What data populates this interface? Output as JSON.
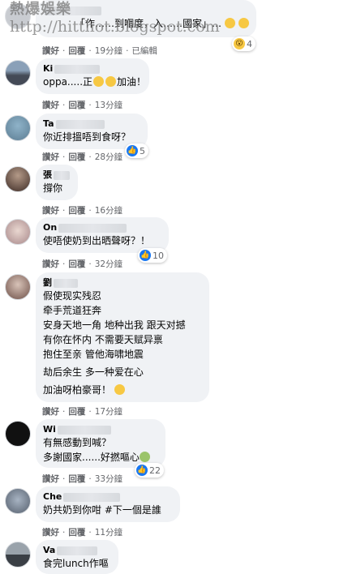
{
  "watermark": {
    "line1": "熱爆娛樂",
    "line2": "http://hitthot.blogspot.com"
  },
  "colors": {
    "bubble_bg": "#f0f2f5",
    "meta_text": "#65676b",
    "like_blue": "#1877f2",
    "emoji_yellow": "#f7c843"
  },
  "comments": [
    {
      "author": "",
      "lines": [
        "「作……到嗰度，入……國家」…"
      ],
      "actions": {
        "like": "讚好",
        "reply": "回覆",
        "time": "19分鐘",
        "extra": "已編輯"
      },
      "reactions": {
        "icons": [
          "wow-icon"
        ],
        "count": "4"
      }
    },
    {
      "author": "Ki",
      "lines": [
        "oppa.....正",
        "加油！"
      ],
      "actions": {
        "like": "讚好",
        "reply": "回覆",
        "time": "13分鐘"
      }
    },
    {
      "author": "Ta",
      "lines": [
        "你近排搵唔到食呀？"
      ],
      "actions": {
        "like": "讚好",
        "reply": "回覆",
        "time": "28分鐘"
      },
      "reactions": {
        "icons": [
          "like-icon"
        ],
        "count": "5"
      }
    },
    {
      "author": "張",
      "lines": [
        "撐你"
      ],
      "actions": {
        "like": "讚好",
        "reply": "回覆",
        "time": "16分鐘"
      }
    },
    {
      "author": "On",
      "lines": [
        "使唔使奶到出晒聲呀？！"
      ],
      "actions": {
        "like": "讚好",
        "reply": "回覆",
        "time": "32分鐘"
      },
      "reactions": {
        "icons": [
          "like-icon"
        ],
        "count": "10"
      }
    },
    {
      "author": "劉",
      "lines": [
        "假使现实残忍",
        "牵手荒道狂奔",
        "安身天地一角 地种出我 跟天对撼",
        "有你在怀内 不需要天赋异禀",
        "抱住至亲 管他海啸地震",
        "",
        "劫后余生 多一种爱在心",
        "",
        "加油呀柏豪哥！"
      ],
      "actions": {
        "like": "讚好",
        "reply": "回覆",
        "time": "17分鐘"
      }
    },
    {
      "author": "Wi",
      "lines": [
        "有無感動到喊？",
        "多謝國家......好撚嘔心"
      ],
      "actions": {
        "like": "讚好",
        "reply": "回覆",
        "time": "33分鐘"
      },
      "reactions": {
        "icons": [
          "like-icon"
        ],
        "count": "22"
      }
    },
    {
      "author": "Che",
      "lines": [
        "奶共奶到你咁 #下一個是誰"
      ],
      "actions": {
        "like": "讚好",
        "reply": "回覆",
        "time": "11分鐘"
      }
    },
    {
      "author": "Va",
      "lines": [
        "食完lunch作嘔"
      ],
      "actions": {
        "like": "讚好",
        "reply": "回覆",
        "time": ""
      }
    }
  ]
}
